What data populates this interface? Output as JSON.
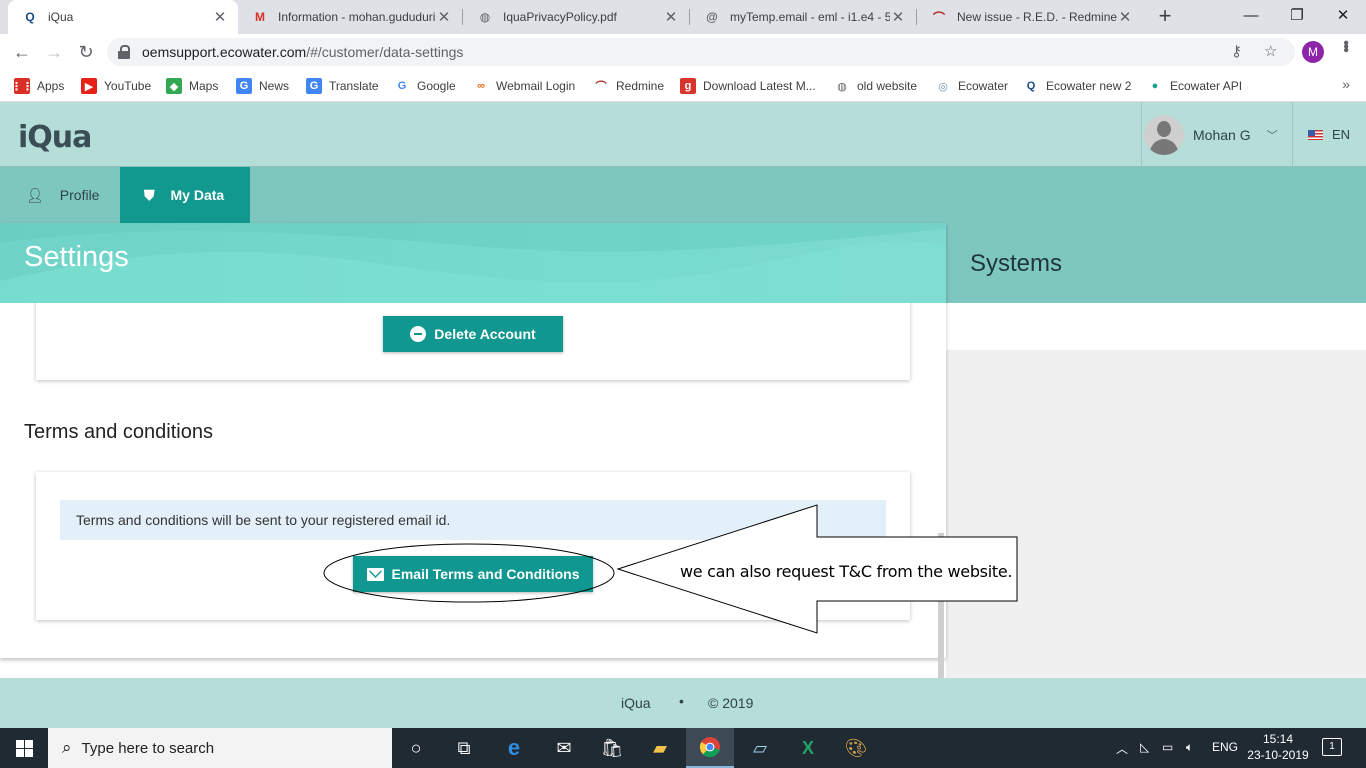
{
  "browser": {
    "tabs": [
      {
        "title": "iQua",
        "favicon": "iqua-icon",
        "favicon_glyph": "Q",
        "favicon_color": "#1a4a8a",
        "active": true
      },
      {
        "title": "Information - mohan.gududuri",
        "favicon": "gmail-icon",
        "favicon_glyph": "M",
        "favicon_color": "#d93025",
        "active": false
      },
      {
        "title": "IquaPrivacyPolicy.pdf",
        "favicon": "globe-icon",
        "favicon_glyph": "◍",
        "favicon_color": "#5f6368",
        "active": false
      },
      {
        "title": "myTemp.email - eml - i1.e4 - 5",
        "favicon": "at-icon",
        "favicon_glyph": "@",
        "favicon_color": "#5f6368",
        "active": false
      },
      {
        "title": "New issue - R.E.D. - Redmine",
        "favicon": "redmine-icon",
        "favicon_glyph": "⌒",
        "favicon_color": "#b3261e",
        "active": false
      }
    ],
    "url_host": "oemsupport.ecowater.com",
    "url_path": "/#/customer/data-settings",
    "profile_initial": "M",
    "bookmarks": [
      {
        "label": "Apps",
        "icon": "apps-grid-icon",
        "glyph": "⋮⋮",
        "color": "#d93025"
      },
      {
        "label": "YouTube",
        "icon": "youtube-icon",
        "glyph": "▶",
        "color": "#e62117"
      },
      {
        "label": "Maps",
        "icon": "maps-icon",
        "glyph": "◆",
        "color": "#34a853"
      },
      {
        "label": "News",
        "icon": "news-icon",
        "glyph": "G",
        "color": "#4285f4"
      },
      {
        "label": "Translate",
        "icon": "translate-icon",
        "glyph": "G",
        "color": "#4285f4"
      },
      {
        "label": "Google",
        "icon": "google-icon",
        "glyph": "G",
        "color": "#4285f4"
      },
      {
        "label": "Webmail Login",
        "icon": "webmail-icon",
        "glyph": "∞",
        "color": "#f26b1d"
      },
      {
        "label": "Redmine",
        "icon": "redmine-icon",
        "glyph": "⌒",
        "color": "#b3261e"
      },
      {
        "label": "Download Latest M...",
        "icon": "download-icon",
        "glyph": "g",
        "color": "#d9342b"
      },
      {
        "label": "old website",
        "icon": "globe-icon",
        "glyph": "◍",
        "color": "#5f6368"
      },
      {
        "label": "Ecowater",
        "icon": "ecowater-icon",
        "glyph": "◎",
        "color": "#6a8fb0"
      },
      {
        "label": "Ecowater new 2",
        "icon": "iqua-icon",
        "glyph": "Q",
        "color": "#1a4a8a"
      },
      {
        "label": "Ecowater API",
        "icon": "drop-icon",
        "glyph": "●",
        "color": "#18a08f"
      }
    ]
  },
  "app": {
    "logo_text": "iQua",
    "user_name": "Mohan G",
    "language": "EN",
    "subnav": [
      {
        "label": "Profile",
        "icon": "person-icon",
        "active": false
      },
      {
        "label": "My Data",
        "icon": "shield-icon",
        "active": true
      }
    ],
    "settings": {
      "title": "Settings",
      "delete_button": "Delete Account",
      "terms_heading": "Terms and conditions",
      "terms_info": "Terms and conditions will be sent to your registered email id.",
      "email_button": "Email Terms and Conditions"
    },
    "systems": {
      "title": "Systems"
    },
    "footer": {
      "brand": "iQua",
      "separator": "•",
      "copyright": "© 2019"
    }
  },
  "annotation": {
    "callout_text": "we can also request T&C from the website."
  },
  "taskbar": {
    "search_placeholder": "Type here to search",
    "language": "ENG",
    "time": "15:14",
    "date": "23-10-2019",
    "notification_count": "1",
    "pinned": [
      "cortana-icon",
      "task-view-icon",
      "edge-icon",
      "mail-icon",
      "store-icon",
      "file-explorer-icon",
      "chrome-icon",
      "notepad-icon",
      "excel-icon",
      "paint-icon"
    ]
  },
  "colors": {
    "accent": "#0f9790",
    "header_bg": "#b5ded8",
    "subnav_bg": "#7ec7bf",
    "banner_bg": "#6fd3c7"
  }
}
